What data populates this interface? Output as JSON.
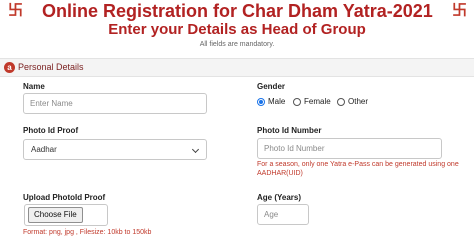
{
  "header": {
    "symbol": "卐",
    "title": "Online Registration for Char Dham Yatra-2021",
    "subtitle": "Enter your Details as Head of Group",
    "mandatory_note": "All fields are mandatory."
  },
  "section": {
    "badge": "a",
    "title": "Personal Details"
  },
  "fields": {
    "name": {
      "label": "Name",
      "placeholder": "Enter Name",
      "value": ""
    },
    "gender": {
      "label": "Gender",
      "options": [
        "Male",
        "Female",
        "Other"
      ],
      "selected": "Male"
    },
    "photo_id_proof": {
      "label": "Photo Id Proof",
      "selected": "Aadhar"
    },
    "photo_id_number": {
      "label": "Photo Id Number",
      "placeholder": "Photo Id Number",
      "value": "",
      "note_line1": "For a season, only one Yatra e-Pass can be generated using one",
      "note_line2": "AADHAR(UID)"
    },
    "upload_photo_id": {
      "label": "Upload PhotoId Proof",
      "button_label": "Choose File",
      "format_note": "Format: png, jpg , Filesize: 10kb to 150kb"
    },
    "age": {
      "label": "Age (Years)",
      "placeholder": "Age",
      "value": ""
    }
  },
  "colors": {
    "brand_red": "#b22222",
    "note_red": "#c0392b",
    "radio_blue": "#1a73e8"
  }
}
